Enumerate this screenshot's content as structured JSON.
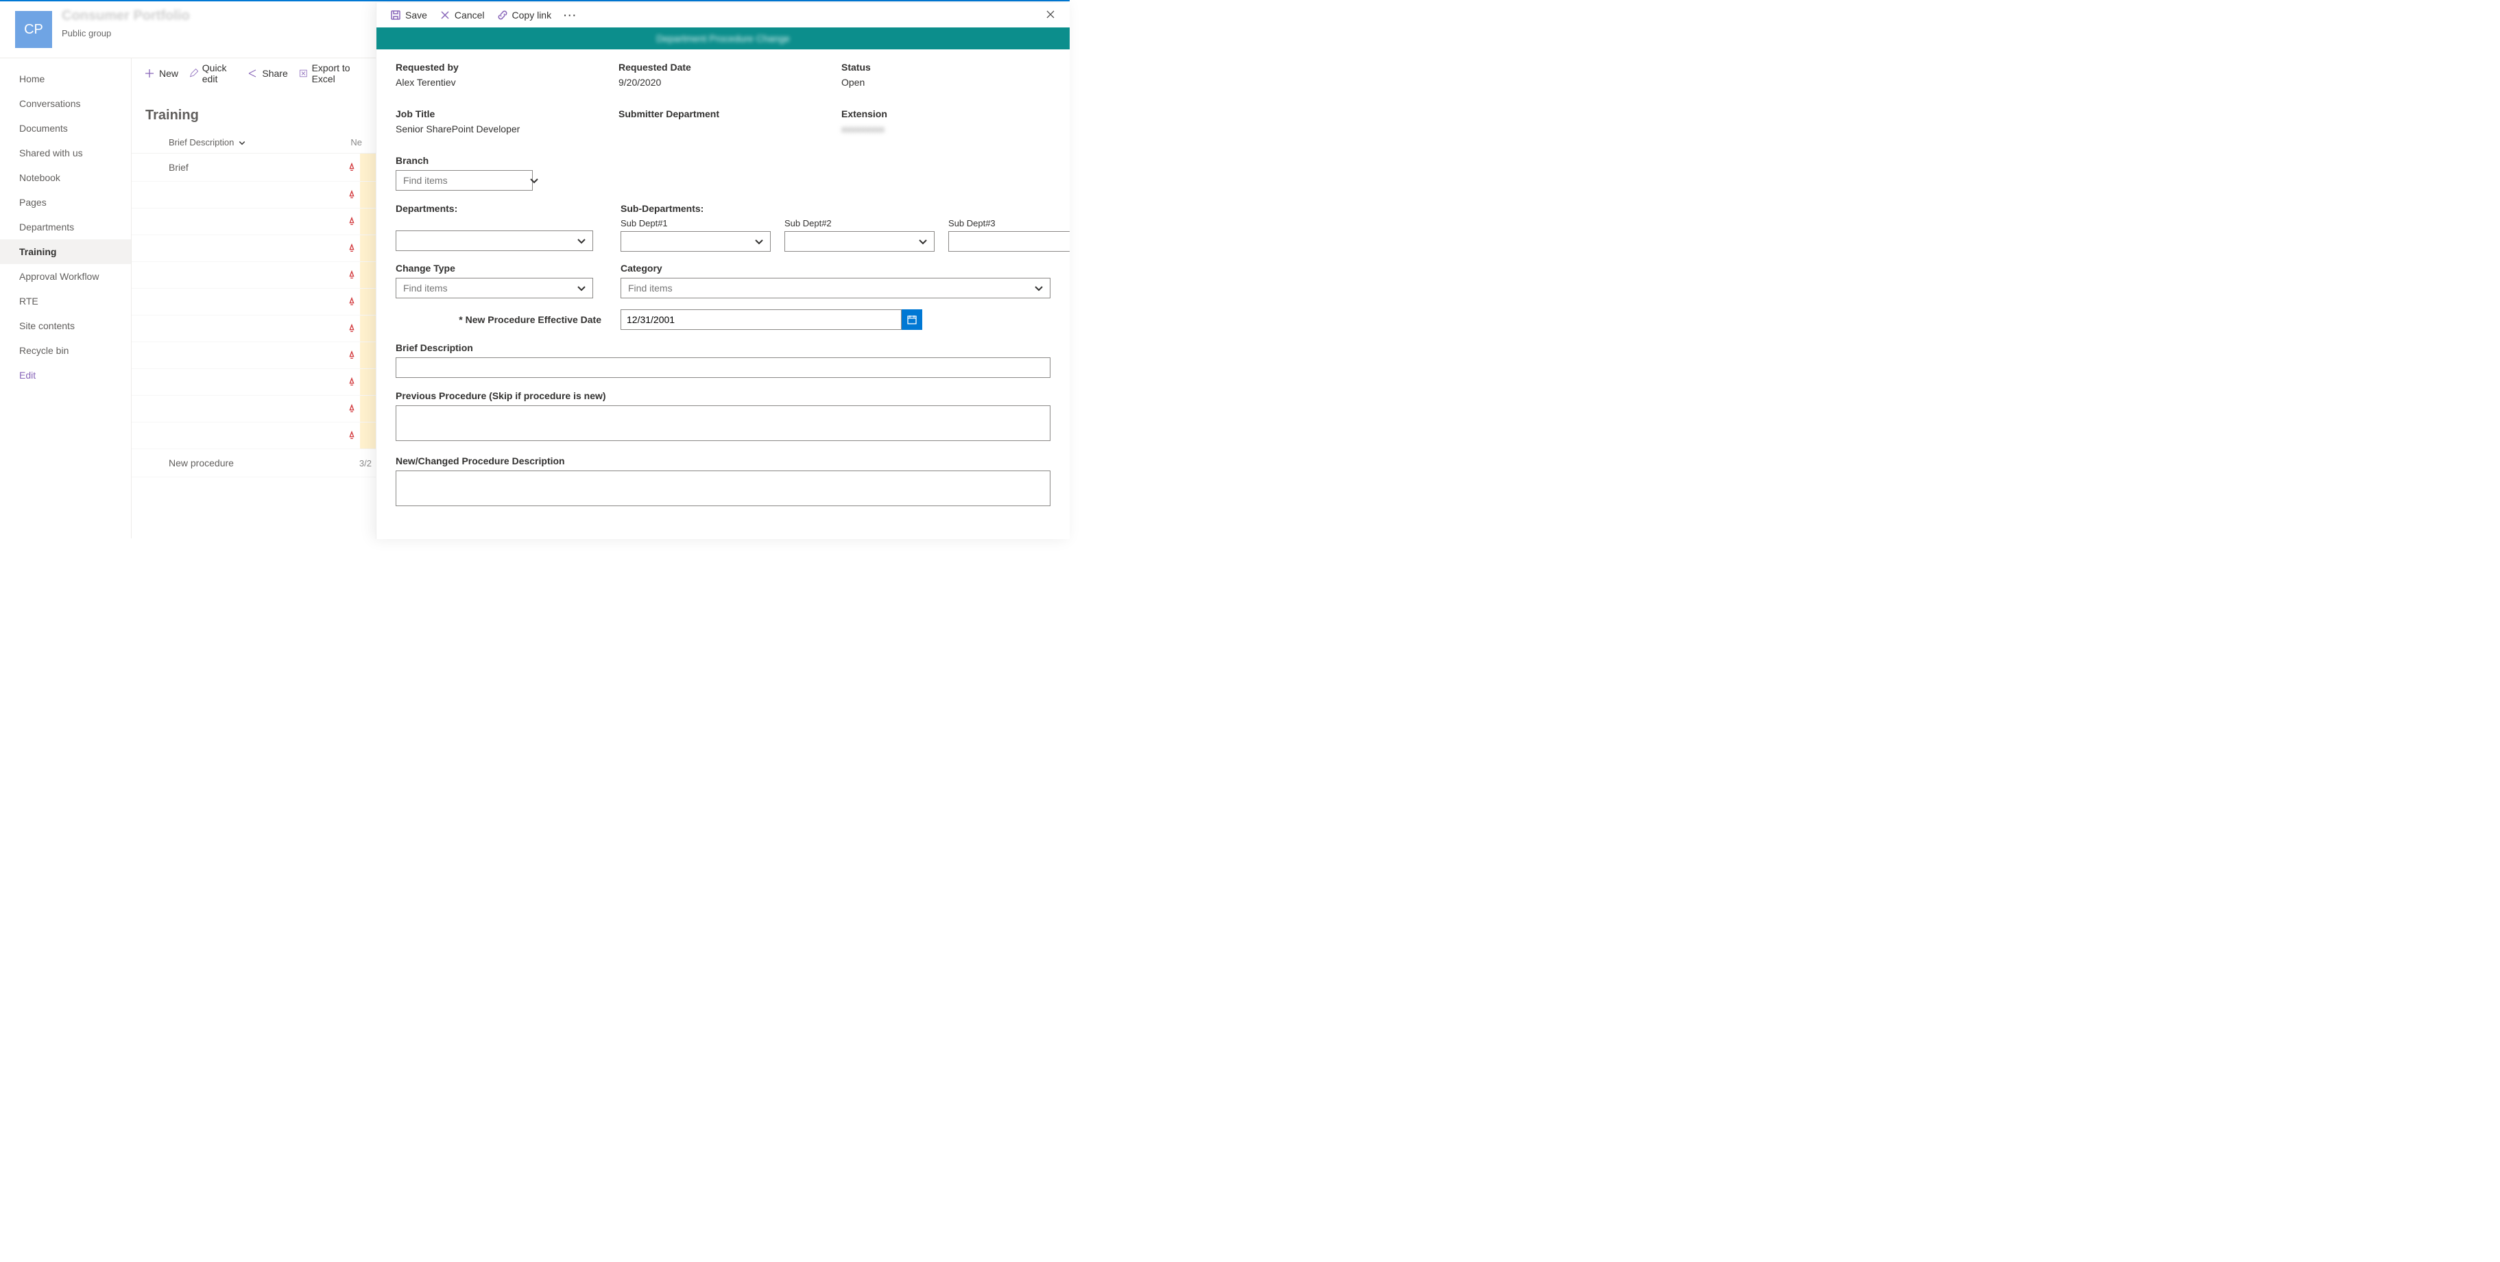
{
  "site": {
    "logo_text": "CP",
    "name_blurred": "Consumer Portfolio",
    "visibility": "Public group"
  },
  "nav": {
    "items": [
      {
        "label": "Home",
        "active": false
      },
      {
        "label": "Conversations",
        "active": false
      },
      {
        "label": "Documents",
        "active": false
      },
      {
        "label": "Shared with us",
        "active": false
      },
      {
        "label": "Notebook",
        "active": false
      },
      {
        "label": "Pages",
        "active": false
      },
      {
        "label": "Departments",
        "active": false
      },
      {
        "label": "Training",
        "active": true
      },
      {
        "label": "Approval Workflow",
        "active": false
      },
      {
        "label": "RTE",
        "active": false
      },
      {
        "label": "Site contents",
        "active": false
      },
      {
        "label": "Recycle bin",
        "active": false
      }
    ],
    "edit_label": "Edit"
  },
  "toolbar": {
    "new_label": "New",
    "quick_edit_label": "Quick edit",
    "share_label": "Share",
    "export_label": "Export to Excel"
  },
  "list": {
    "title": "Training",
    "col_brief": "Brief Description",
    "col_new": "Ne",
    "rows": [
      {
        "title": "Brief"
      },
      {
        "title": ""
      },
      {
        "title": ""
      },
      {
        "title": ""
      },
      {
        "title": ""
      },
      {
        "title": ""
      },
      {
        "title": ""
      },
      {
        "title": ""
      },
      {
        "title": ""
      },
      {
        "title": ""
      },
      {
        "title": ""
      },
      {
        "title": "New procedure",
        "extra": "3/2"
      }
    ]
  },
  "panel": {
    "cmd_save": "Save",
    "cmd_cancel": "Cancel",
    "cmd_copylink": "Copy link",
    "banner_blurred": "Department Procedure Change",
    "fields": {
      "requested_by_label": "Requested by",
      "requested_by_value": "Alex Terentiev",
      "requested_date_label": "Requested Date",
      "requested_date_value": "9/20/2020",
      "status_label": "Status",
      "status_value": "Open",
      "job_title_label": "Job Title",
      "job_title_value": "Senior SharePoint Developer",
      "submitter_dept_label": "Submitter Department",
      "extension_label": "Extension",
      "extension_value_blurred": "xxxxxxxxx",
      "branch_label": "Branch",
      "branch_placeholder": "Find items",
      "departments_label": "Departments:",
      "sub_departments_label": "Sub-Departments:",
      "sub_dept_1": "Sub Dept#1",
      "sub_dept_2": "Sub Dept#2",
      "sub_dept_3": "Sub Dept#3",
      "change_type_label": "Change Type",
      "change_type_placeholder": "Find items",
      "category_label": "Category",
      "category_placeholder": "Find items",
      "eff_date_label": "* New Procedure Effective Date",
      "eff_date_value": "12/31/2001",
      "brief_desc_label": "Brief Description",
      "prev_proc_label": "Previous Procedure (Skip if procedure is new)",
      "new_proc_label": "New/Changed Procedure Description"
    }
  }
}
